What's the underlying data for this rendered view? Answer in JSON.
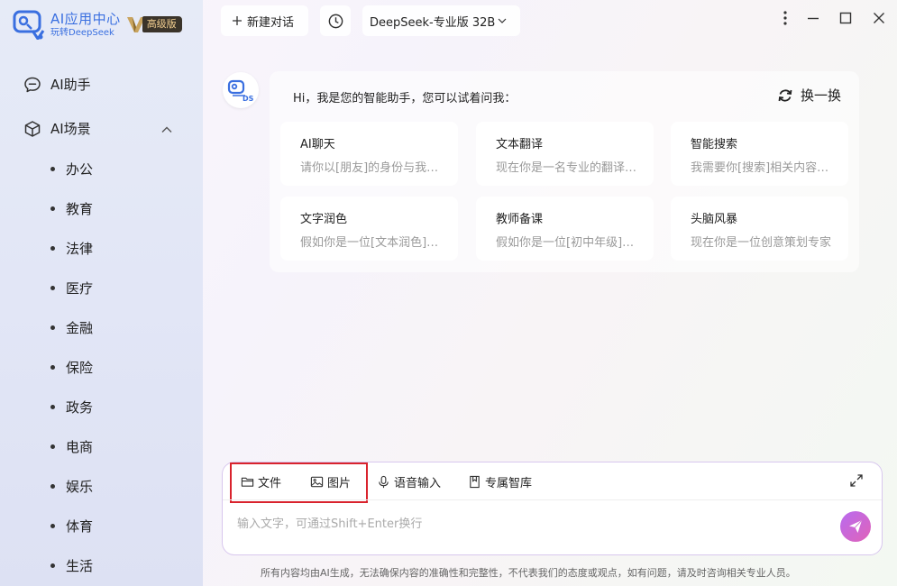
{
  "brand": {
    "name": "AI应用中心",
    "subtitle": "玩转DeepSeek",
    "badge": "高级版"
  },
  "sidebar": {
    "assistant_label": "AI助手",
    "scenes_label": "AI场景",
    "sub_items": [
      "办公",
      "教育",
      "法律",
      "医疗",
      "金融",
      "保险",
      "政务",
      "电商",
      "娱乐",
      "体育",
      "生活"
    ]
  },
  "topbar": {
    "new_chat_label": "新建对话",
    "model_label": "DeepSeek-专业版 32B"
  },
  "welcome": {
    "greeting": "Hi，我是您的智能助手，您可以试着问我：",
    "refresh_label": "换一换",
    "cards": [
      {
        "title": "AI聊天",
        "desc": "请你以[朋友]的身份与我对话"
      },
      {
        "title": "文本翻译",
        "desc": "现在你是一名专业的翻译人员"
      },
      {
        "title": "智能搜索",
        "desc": "我需要你[搜索]相关内容信息"
      },
      {
        "title": "文字润色",
        "desc": "假如你是一位[文本润色]专家"
      },
      {
        "title": "教师备课",
        "desc": "假如你是一位[初中年级]老师"
      },
      {
        "title": "头脑风暴",
        "desc": "现在你是一位创意策划专家"
      }
    ]
  },
  "composer": {
    "file_label": "文件",
    "image_label": "图片",
    "voice_label": "语音输入",
    "kb_label": "专属智库",
    "placeholder": "输入文字，可通过Shift+Enter换行"
  },
  "disclaimer": "所有内容均由AI生成，无法确保内容的准确性和完整性，不代表我们的态度或观点，如有问题，请及时咨询相关专业人员。",
  "colors": {
    "accent": "#3a6fe0",
    "highlight_border": "#d9232d",
    "send_gradient_start": "#b86bf0",
    "send_gradient_end": "#e063b8"
  }
}
